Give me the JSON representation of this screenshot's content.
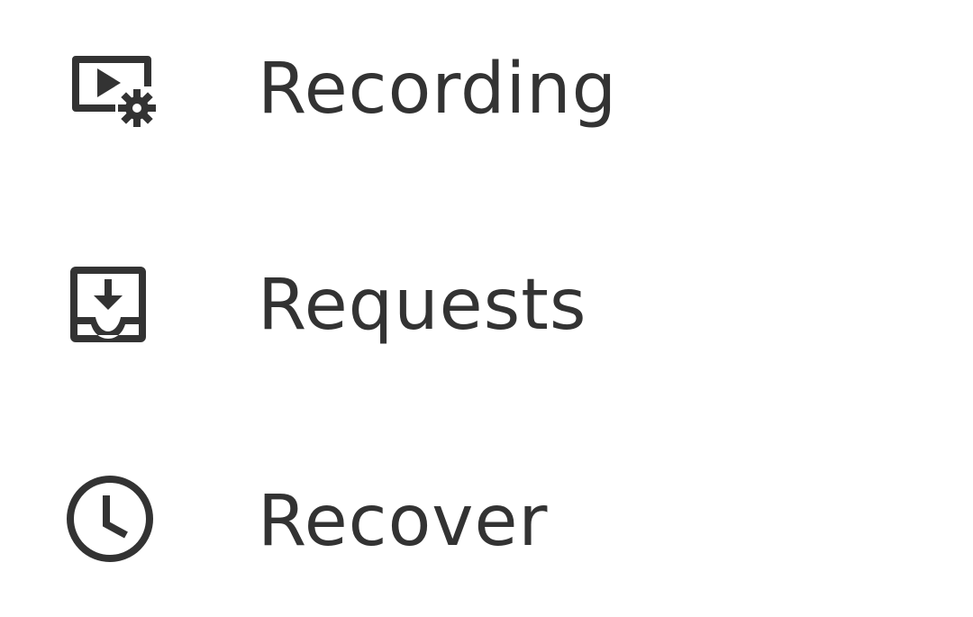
{
  "menu": {
    "items": [
      {
        "label": "Recording",
        "icon": "video-settings-icon"
      },
      {
        "label": "Requests",
        "icon": "inbox-download-icon"
      },
      {
        "label": "Recover",
        "icon": "clock-icon"
      }
    ]
  },
  "colors": {
    "text": "#333333",
    "icon": "#333333",
    "background": "#ffffff"
  }
}
